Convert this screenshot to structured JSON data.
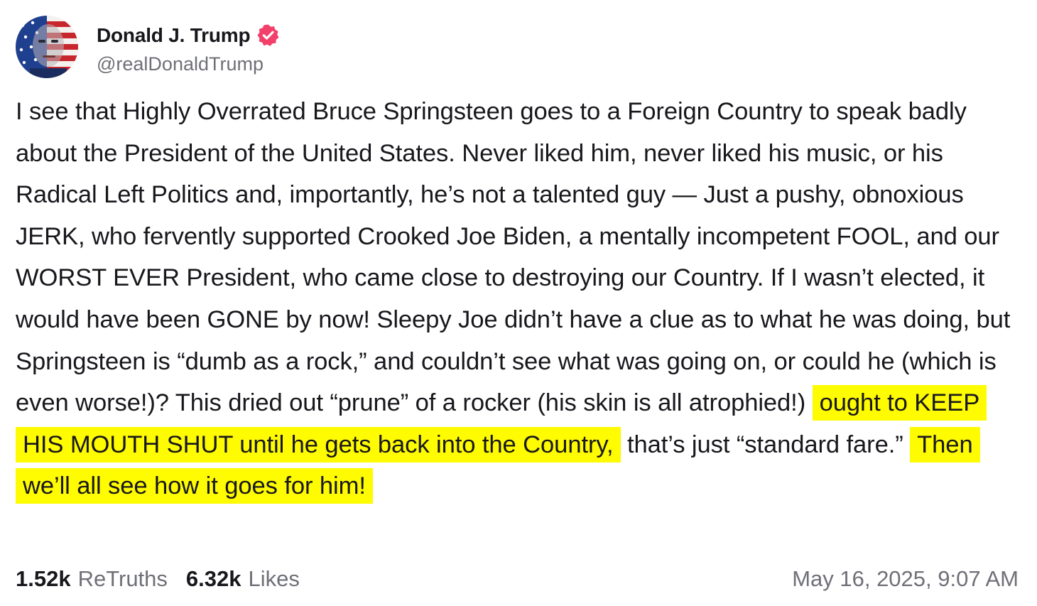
{
  "author": {
    "name": "Donald J. Trump",
    "handle": "@realDonaldTrump",
    "verified_icon": "verified-badge",
    "verified_color": "#f2406a"
  },
  "post": {
    "segments": [
      {
        "text": "I see that Highly Overrated Bruce Springsteen goes to a Foreign Country to speak badly about the President of the United States. Never liked him, never liked his music, or his Radical Left Politics and, importantly, he’s not a talented guy — Just a pushy, obnoxious JERK, who fervently supported Crooked Joe Biden, a mentally incompetent FOOL, and our WORST EVER President, who came close to destroying our Country. If I wasn’t elected, it would have been GONE by now! Sleepy Joe didn’t have a clue as to what he was doing, but Springsteen is “dumb as a rock,” and couldn’t see what was going on, or could he (which is even worse!)? This dried out “prune” of a rocker (his skin is all atrophied!) ",
        "highlighted": false
      },
      {
        "text": "ought to KEEP HIS MOUTH SHUT until he gets back into the Country,",
        "highlighted": true
      },
      {
        "text": " that’s just “standard fare.” ",
        "highlighted": false
      },
      {
        "text": "Then we’ll all see how it goes for him!",
        "highlighted": true
      }
    ],
    "highlight_color": "#fffb00"
  },
  "stats": {
    "retruths_count": "1.52k",
    "retruths_label": "ReTruths",
    "likes_count": "6.32k",
    "likes_label": "Likes"
  },
  "timestamp": "May 16, 2025, 9:07 AM"
}
